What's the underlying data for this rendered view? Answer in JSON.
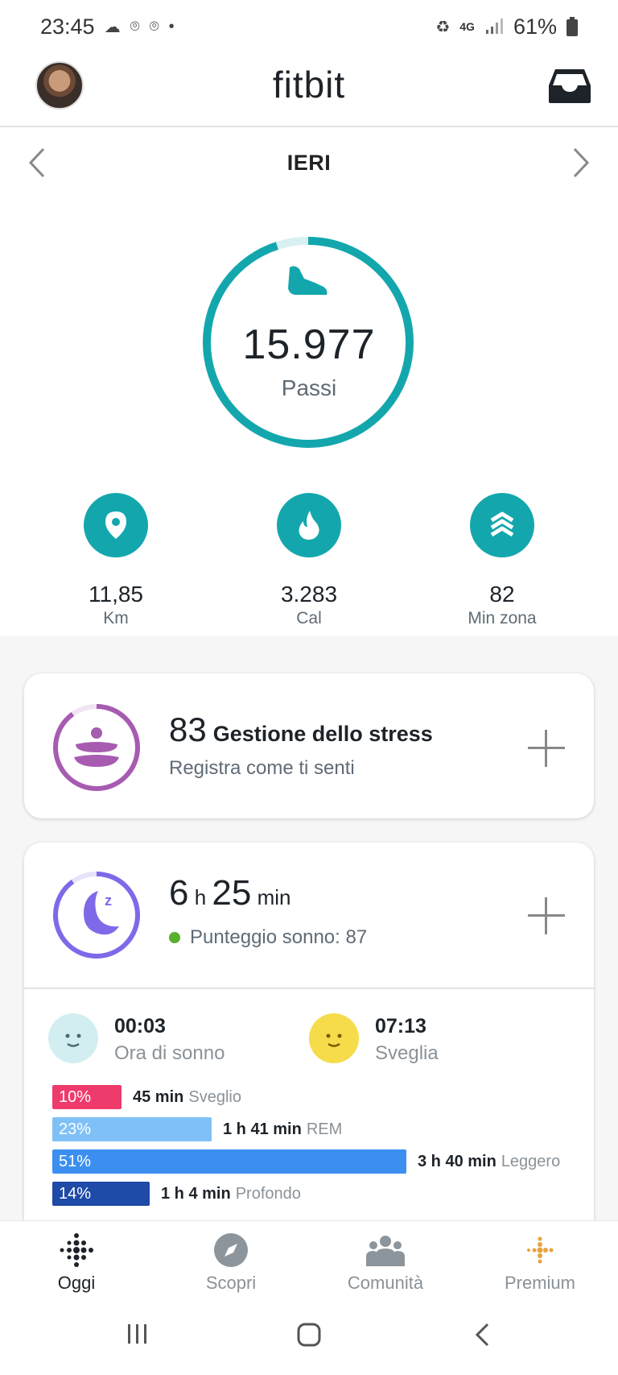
{
  "status_bar": {
    "time": "23:45",
    "battery": "61%",
    "network": "4G",
    "icons": [
      "cloud-icon",
      "location-pin-icon",
      "location-pin-icon",
      "dot-icon",
      "recycle-icon",
      "signal-icon",
      "battery-icon"
    ]
  },
  "header": {
    "title": "fitbit",
    "avatar": "avatar",
    "inbox_icon": "inbox-icon"
  },
  "day_nav": {
    "label": "IERI",
    "prev_icon": "chevron-left-icon",
    "next_icon": "chevron-right-icon"
  },
  "steps": {
    "value": "15.977",
    "label": "Passi",
    "goal_progress": 0.95,
    "icon": "shoe-icon",
    "ring_color": "#13a7ad",
    "ring_track_color": "#d8f0f2"
  },
  "stats": [
    {
      "value": "11,85",
      "label": "Km",
      "icon": "location-pin-icon"
    },
    {
      "value": "3.283",
      "label": "Cal",
      "icon": "flame-icon"
    },
    {
      "value": "82",
      "label": "Min zona",
      "icon": "zone-chevrons-icon"
    }
  ],
  "stress_card": {
    "score": "83",
    "title": "Gestione dello stress",
    "subtitle": "Registra come ti senti",
    "ring_progress": 0.9,
    "color": "#a75bb1"
  },
  "sleep_card": {
    "hours": "6",
    "hours_unit": "h",
    "minutes": "25",
    "minutes_unit": "min",
    "score_text": "Punteggio sonno: 87",
    "ring_progress": 0.9,
    "color": "#8069e8",
    "bedtime": {
      "time": "00:03",
      "label": "Ora di sonno"
    },
    "wake": {
      "time": "07:13",
      "label": "Sveglia"
    },
    "stages": [
      {
        "percent": "10%",
        "value": 10,
        "duration": "45 min",
        "name": "Sveglio",
        "color": "#ee3b6c"
      },
      {
        "percent": "23%",
        "value": 23,
        "duration": "1 h 41 min",
        "name": "REM",
        "color": "#7fc1f7"
      },
      {
        "percent": "51%",
        "value": 51,
        "duration": "3 h 40 min",
        "name": "Leggero",
        "color": "#3c8ff0"
      },
      {
        "percent": "14%",
        "value": 14,
        "duration": "1 h 4 min",
        "name": "Profondo",
        "color": "#1e4aa8"
      }
    ]
  },
  "bottom_nav": [
    {
      "label": "Oggi",
      "icon": "fitbit-dots-icon",
      "active": true
    },
    {
      "label": "Scopri",
      "icon": "compass-icon",
      "active": false
    },
    {
      "label": "Comunità",
      "icon": "community-icon",
      "active": false
    },
    {
      "label": "Premium",
      "icon": "premium-dots-icon",
      "active": false
    }
  ],
  "system_nav": [
    "recents-icon",
    "home-icon",
    "back-icon"
  ],
  "colors": {
    "accent": "#13a7ad",
    "stress": "#a75bb1",
    "sleep": "#8069e8",
    "premium": "#e8a33d"
  }
}
